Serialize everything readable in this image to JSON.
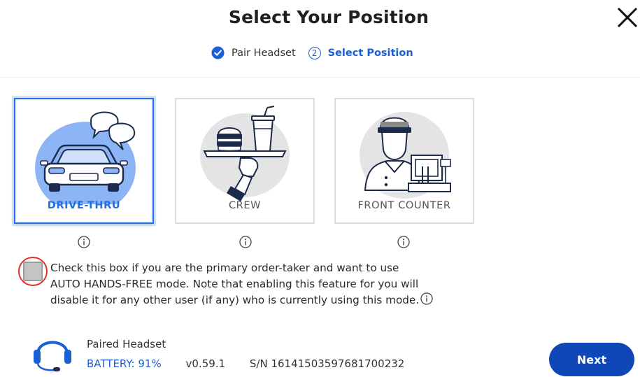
{
  "header": {
    "title": "Select Your Position",
    "close_icon": "close-icon"
  },
  "stepper": {
    "step1_label": "Pair Headset",
    "step1_state": "completed",
    "step2_number": "2",
    "step2_label": "Select Position",
    "accent_color": "#1a5fd6"
  },
  "positions": [
    {
      "label": "DRIVE-THRU",
      "icon": "drive-thru-icon",
      "selected": true
    },
    {
      "label": "CREW",
      "icon": "crew-icon",
      "selected": false
    },
    {
      "label": "FRONT COUNTER",
      "icon": "front-counter-icon",
      "selected": false
    }
  ],
  "primary_order_taker": {
    "checked": false,
    "lines": [
      "Check this box if you are the primary order-taker and want to use",
      "AUTO HANDS-FREE mode. Note that enabling this feature for you will",
      "disable it for any other user (if any) who is currently using this mode."
    ]
  },
  "headset": {
    "title": "Paired Headset",
    "battery": "BATTERY: 91%",
    "version": "v0.59.1",
    "serial": "S/N 16141503597681700232"
  },
  "footer": {
    "next_label": "Next",
    "button_color": "#0f47b9"
  }
}
